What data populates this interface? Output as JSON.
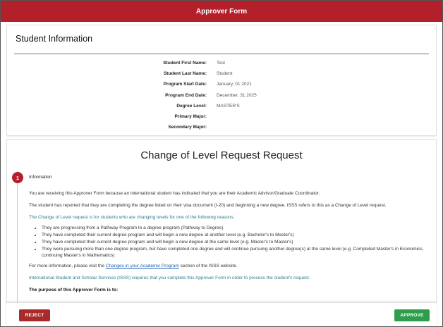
{
  "header": {
    "title": "Approver Form"
  },
  "student": {
    "heading": "Student Information",
    "fields": [
      {
        "label": "Student First Name:",
        "value": "Test"
      },
      {
        "label": "Student Last Name:",
        "value": "Student"
      },
      {
        "label": "Program Start Date:",
        "value": "January, 01 2021"
      },
      {
        "label": "Program End Date:",
        "value": "December, 31 2025"
      },
      {
        "label": "Degree Level:",
        "value": "MASTER'S"
      },
      {
        "label": "Primary Major:",
        "value": ""
      },
      {
        "label": "Secondary Major:",
        "value": ""
      }
    ]
  },
  "request": {
    "title": "Change of Level Request Request",
    "step": {
      "number": "1",
      "label": "Information"
    },
    "para1": "You are receiving this Approver Form because an international student has indicated that you are their Academic Advisor/Graduate Coordinator.",
    "para2": "The student has reported that they are completing the degree listed on their visa document (I-20) and beginning a new degree. ISSS refers to this as a Change of Level request.",
    "para3": "The Change of Level request is for students who are changing levels for one of the following reasons:",
    "reasons": [
      "They are progressing from a Pathway Program to a degree program (Pathway to Degree).",
      "They have completed their current degree program and will begin a new degree at another level (e.g. Bachelor's to Master's)",
      "They have completed their current degree program and will begin a new degree at the same level (e.g. Master's to Master's)",
      "They were pursuing more than one degree program, but have completed one degree and will continue pursuing another degree(s) at the same level (e.g. Completed Master's in Economics, continuing Master's in Mathematics)"
    ],
    "more_info_prefix": "For more information, please visit the ",
    "more_info_link": "Changes in your Academic Program",
    "more_info_suffix": " section of the ISSS website.",
    "para5": "International Student and Scholar Services (ISSS) requires that you complete this Approver Form in order to process the student's request.",
    "purpose": "The purpose of this Approver Form is to:"
  },
  "footer": {
    "reject_label": "REJECT",
    "approve_label": "APPROVE"
  },
  "colors": {
    "brand": "#b3202a",
    "reject": "#a82a2a",
    "approve": "#2e9e4d"
  }
}
